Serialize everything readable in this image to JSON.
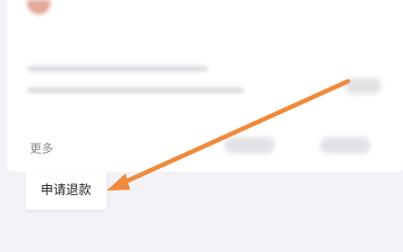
{
  "order_card": {
    "more_label": "更多"
  },
  "more_menu": {
    "items": [
      {
        "label": "申请退款"
      }
    ]
  },
  "annotation": {
    "arrow_color": "#f08a3c"
  }
}
